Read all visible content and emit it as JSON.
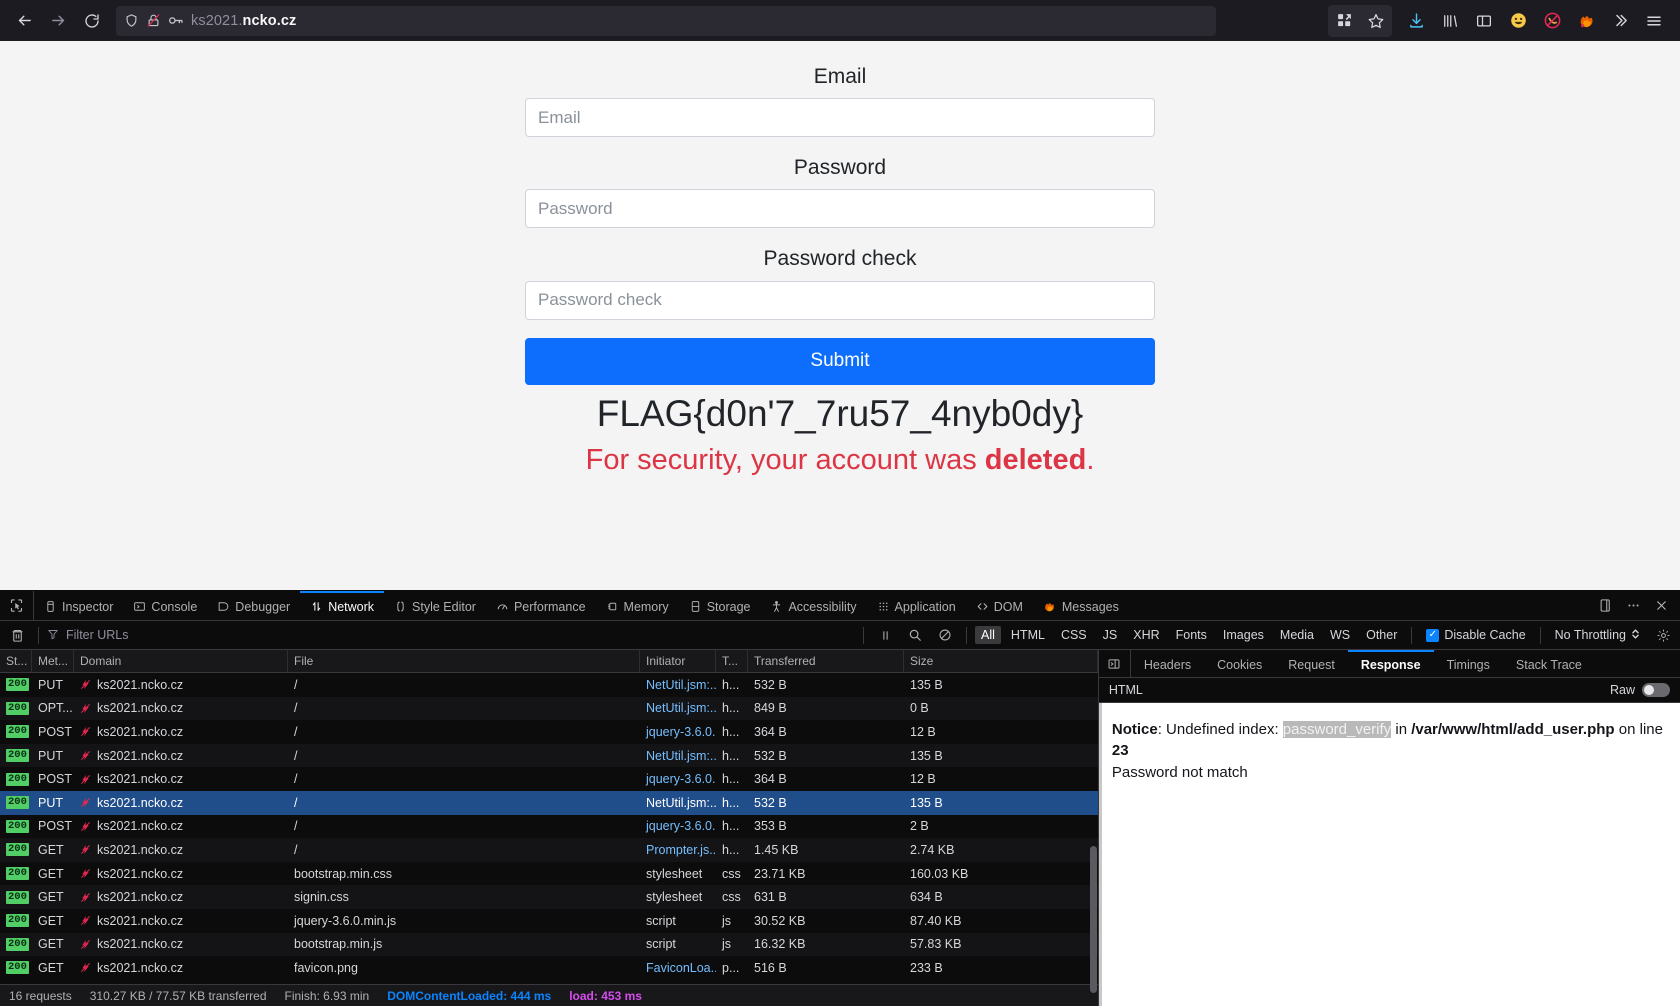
{
  "browser": {
    "url_prefix": "ks2021.",
    "url_domain": "ncko.cz",
    "nav": {
      "back": "back-arrow",
      "forward": "forward-arrow",
      "reload": "reload"
    },
    "urlbar_icons": [
      "shield-icon",
      "no-lock-icon",
      "key-icon"
    ],
    "toolbar_icons": [
      "extensions-icon",
      "bookmark-star-icon",
      "download-icon",
      "library-icon",
      "sidebar-icon",
      "smiley-icon",
      "pocket-icon",
      "firefox-account-icon",
      "overflow-chevrons-icon",
      "hamburger-menu-icon"
    ]
  },
  "page": {
    "fields": [
      {
        "label": "Email",
        "placeholder": "Email",
        "value": "",
        "type": "text",
        "name": "email"
      },
      {
        "label": "Password",
        "placeholder": "Password",
        "value": "",
        "type": "password",
        "name": "password"
      },
      {
        "label": "Password check",
        "placeholder": "Password check",
        "value": "",
        "type": "password",
        "name": "password-check"
      }
    ],
    "submit_label": "Submit",
    "flag": "FLAG{d0n'7_7ru57_4nyb0dy}",
    "notice_prefix": "For security, your account was ",
    "notice_bold": "deleted",
    "notice_suffix": ".",
    "accent_blue": "#0d6efd",
    "danger_red": "#dc3545"
  },
  "devtools": {
    "tabs": [
      {
        "label": "Inspector",
        "icon": "inspector-icon",
        "active": false
      },
      {
        "label": "Console",
        "icon": "console-icon",
        "active": false
      },
      {
        "label": "Debugger",
        "icon": "debugger-icon",
        "active": false
      },
      {
        "label": "Network",
        "icon": "network-icon",
        "active": true
      },
      {
        "label": "Style Editor",
        "icon": "style-editor-icon",
        "active": false
      },
      {
        "label": "Performance",
        "icon": "performance-icon",
        "active": false
      },
      {
        "label": "Memory",
        "icon": "memory-icon",
        "active": false
      },
      {
        "label": "Storage",
        "icon": "storage-icon",
        "active": false
      },
      {
        "label": "Accessibility",
        "icon": "accessibility-icon",
        "active": false
      },
      {
        "label": "Application",
        "icon": "application-icon",
        "active": false
      },
      {
        "label": "DOM",
        "icon": "dom-icon",
        "active": false
      },
      {
        "label": "Messages",
        "icon": "messages-firefox-icon",
        "active": false
      }
    ],
    "tabbar_right_icons": [
      "dock-layout-icon",
      "meatball-menu-icon",
      "close-icon"
    ],
    "network_toolbar": {
      "trash_icon": "trash-icon",
      "filter_placeholder": "Filter URLs",
      "filter_value": "",
      "pause_icon": "pause-icon",
      "search_icon": "search-icon",
      "block_icon": "block-icon",
      "type_filters": [
        "All",
        "HTML",
        "CSS",
        "JS",
        "XHR",
        "Fonts",
        "Images",
        "Media",
        "WS",
        "Other"
      ],
      "type_filter_active": "All",
      "disable_cache_label": "Disable Cache",
      "disable_cache_checked": true,
      "throttling_label": "No Throttling",
      "settings_icon": "gear-icon"
    },
    "columns": [
      "St...",
      "Met...",
      "Domain",
      "File",
      "Initiator",
      "T...",
      "Transferred",
      "Size"
    ],
    "rows": [
      {
        "status": "200",
        "method": "PUT",
        "domain": "ks2021.ncko.cz",
        "file": "/",
        "initiator": "NetUtil.jsm:...",
        "initiator_link": true,
        "type": "h...",
        "transferred": "532 B",
        "size": "135 B",
        "selected": false
      },
      {
        "status": "200",
        "method": "OPT...",
        "domain": "ks2021.ncko.cz",
        "file": "/",
        "initiator": "NetUtil.jsm:...",
        "initiator_link": true,
        "type": "h...",
        "transferred": "849 B",
        "size": "0 B",
        "selected": false
      },
      {
        "status": "200",
        "method": "POST",
        "domain": "ks2021.ncko.cz",
        "file": "/",
        "initiator": "jquery-3.6.0...",
        "initiator_link": true,
        "type": "h...",
        "transferred": "364 B",
        "size": "12 B",
        "selected": false
      },
      {
        "status": "200",
        "method": "PUT",
        "domain": "ks2021.ncko.cz",
        "file": "/",
        "initiator": "NetUtil.jsm:...",
        "initiator_link": true,
        "type": "h...",
        "transferred": "532 B",
        "size": "135 B",
        "selected": false
      },
      {
        "status": "200",
        "method": "POST",
        "domain": "ks2021.ncko.cz",
        "file": "/",
        "initiator": "jquery-3.6.0...",
        "initiator_link": true,
        "type": "h...",
        "transferred": "364 B",
        "size": "12 B",
        "selected": false
      },
      {
        "status": "200",
        "method": "PUT",
        "domain": "ks2021.ncko.cz",
        "file": "/",
        "initiator": "NetUtil.jsm:...",
        "initiator_link": true,
        "type": "h...",
        "transferred": "532 B",
        "size": "135 B",
        "selected": true
      },
      {
        "status": "200",
        "method": "POST",
        "domain": "ks2021.ncko.cz",
        "file": "/",
        "initiator": "jquery-3.6.0...",
        "initiator_link": true,
        "type": "h...",
        "transferred": "353 B",
        "size": "2 B",
        "selected": false
      },
      {
        "status": "200",
        "method": "GET",
        "domain": "ks2021.ncko.cz",
        "file": "/",
        "initiator": "Prompter.js...",
        "initiator_link": true,
        "type": "h...",
        "transferred": "1.45 KB",
        "size": "2.74 KB",
        "selected": false
      },
      {
        "status": "200",
        "method": "GET",
        "domain": "ks2021.ncko.cz",
        "file": "bootstrap.min.css",
        "initiator": "stylesheet",
        "initiator_link": false,
        "type": "css",
        "transferred": "23.71 KB",
        "size": "160.03 KB",
        "selected": false
      },
      {
        "status": "200",
        "method": "GET",
        "domain": "ks2021.ncko.cz",
        "file": "signin.css",
        "initiator": "stylesheet",
        "initiator_link": false,
        "type": "css",
        "transferred": "631 B",
        "size": "634 B",
        "selected": false
      },
      {
        "status": "200",
        "method": "GET",
        "domain": "ks2021.ncko.cz",
        "file": "jquery-3.6.0.min.js",
        "initiator": "script",
        "initiator_link": false,
        "type": "js",
        "transferred": "30.52 KB",
        "size": "87.40 KB",
        "selected": false
      },
      {
        "status": "200",
        "method": "GET",
        "domain": "ks2021.ncko.cz",
        "file": "bootstrap.min.js",
        "initiator": "script",
        "initiator_link": false,
        "type": "js",
        "transferred": "16.32 KB",
        "size": "57.83 KB",
        "selected": false
      },
      {
        "status": "200",
        "method": "GET",
        "domain": "ks2021.ncko.cz",
        "file": "favicon.png",
        "initiator": "FaviconLoa...",
        "initiator_link": true,
        "type": "p...",
        "transferred": "516 B",
        "size": "233 B",
        "selected": false
      }
    ],
    "status_bar": {
      "requests": "16 requests",
      "transferred": "310.27 KB / 77.57 KB transferred",
      "finish": "Finish: 6.93 min",
      "domcontentloaded": "DOMContentLoaded: 444 ms",
      "load": "load: 453 ms"
    },
    "detail": {
      "tabs": [
        "Headers",
        "Cookies",
        "Request",
        "Response",
        "Timings",
        "Stack Trace"
      ],
      "active_tab": "Response",
      "subbar_label": "HTML",
      "raw_label": "Raw",
      "raw_on": false,
      "response": {
        "notice_label": "Notice",
        "line1_a": ": Undefined index: ",
        "highlight": "password_verify",
        "line1_b": " in ",
        "path": "/var/www/html/add_user.php",
        "line2_a": "on line ",
        "line_number": "23",
        "line3": "Password not match"
      }
    }
  }
}
